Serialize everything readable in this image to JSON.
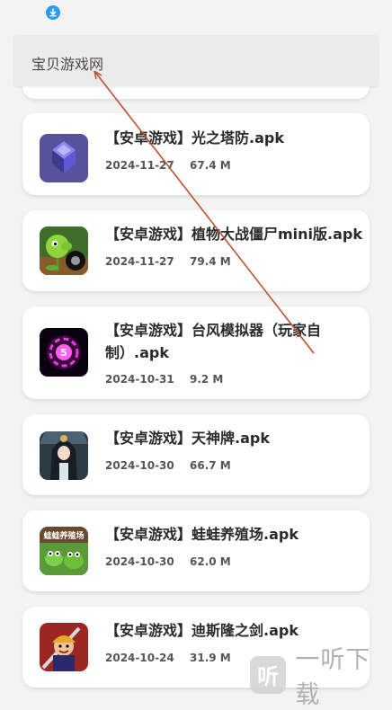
{
  "header": {
    "title": "宝贝游戏网"
  },
  "items": [
    {
      "title": "【安卓游戏】光之塔防.apk",
      "date": "2024-11-27",
      "size": "67.4 M",
      "icon": "tower-defense-icon",
      "accent": "#6b63c9"
    },
    {
      "title": "【安卓游戏】植物大战僵尸mini版.apk",
      "date": "2024-11-27",
      "size": "79.4 M",
      "icon": "peashooter-icon",
      "accent": "#6fbf3a"
    },
    {
      "title": "【安卓游戏】台风模拟器（玩家自制）.apk",
      "date": "2024-10-31",
      "size": "9.2 M",
      "icon": "typhoon-icon",
      "accent": "#d23fc2"
    },
    {
      "title": "【安卓游戏】天神牌.apk",
      "date": "2024-10-30",
      "size": "66.7 M",
      "icon": "deity-card-icon",
      "accent": "#3d5463"
    },
    {
      "title": "【安卓游戏】蛙蛙养殖场.apk",
      "date": "2024-10-30",
      "size": "62.0 M",
      "icon": "frog-farm-icon",
      "accent": "#5aa24a"
    },
    {
      "title": "【安卓游戏】迪斯隆之剑.apk",
      "date": "2024-10-24",
      "size": "31.9 M",
      "icon": "sword-hero-icon",
      "accent": "#c53b2f"
    }
  ],
  "thumb_texts": {
    "typhoon_level": "5",
    "frog_farm": "蛙蛙养殖场"
  },
  "watermark": {
    "text": "一听下载",
    "logo_glyph": "听"
  }
}
